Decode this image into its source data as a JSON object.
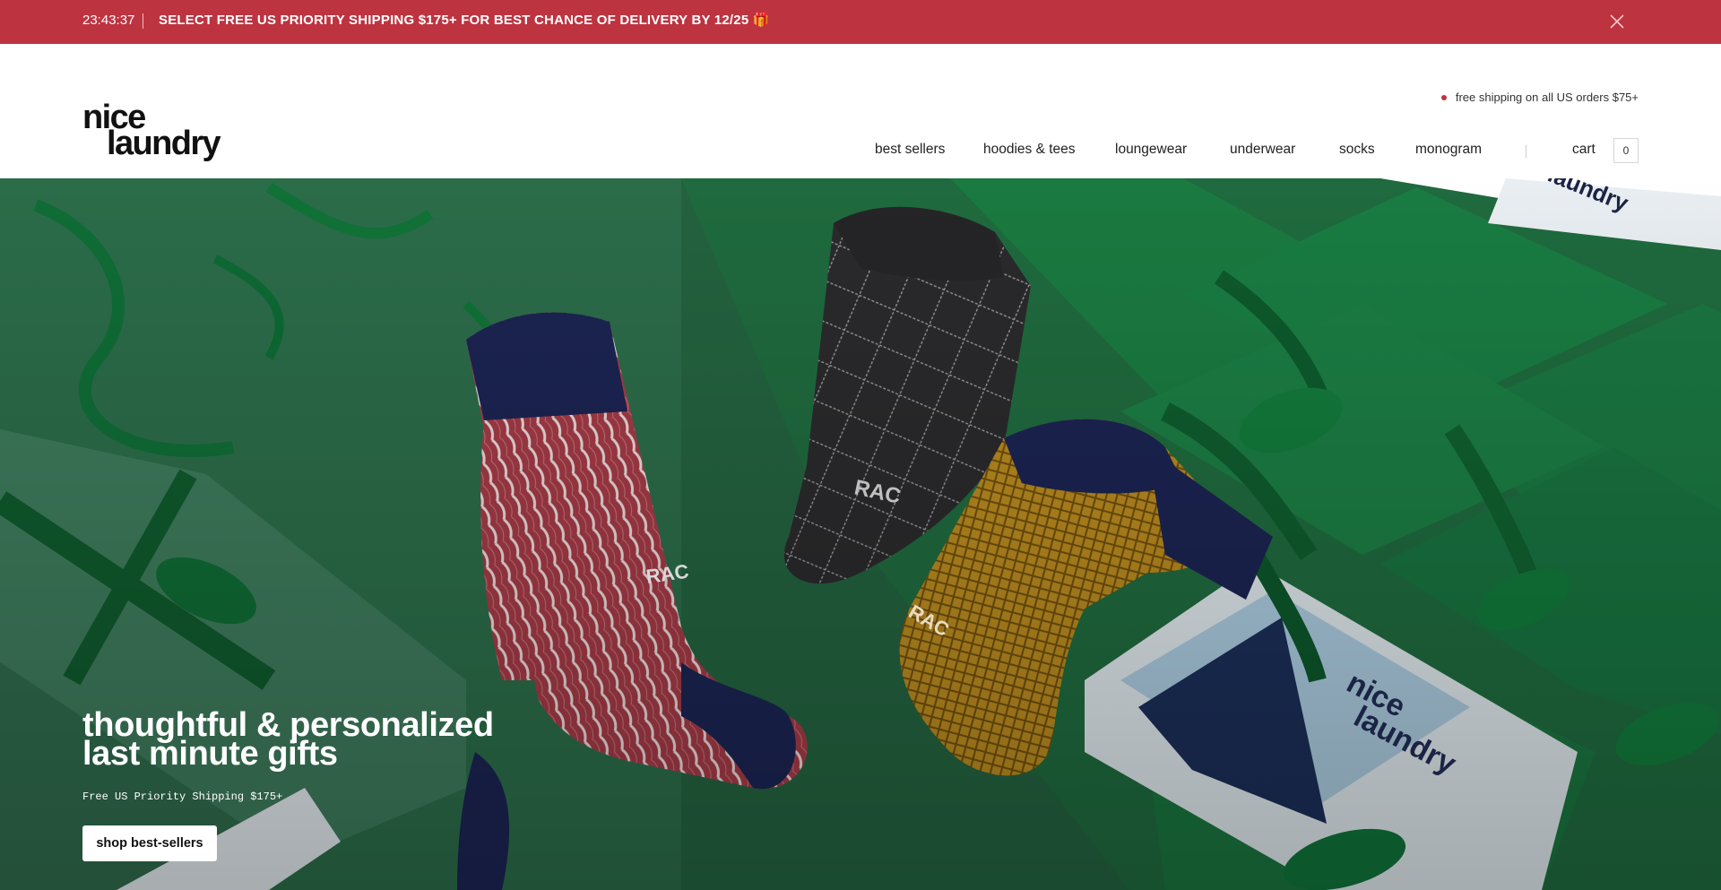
{
  "announcement": {
    "time": "23:43:37",
    "message": "SELECT FREE US PRIORITY SHIPPING $175+ FOR BEST CHANCE OF DELIVERY BY 12/25 🎁",
    "close_icon": "close-icon",
    "background": "#be3340"
  },
  "header": {
    "logo_line1": "nice",
    "logo_line2": "laundry",
    "shipping_note": "free shipping on all US orders $75+",
    "nav": [
      "best sellers",
      "hoodies & tees",
      "loungewear",
      "underwear",
      "socks",
      "monogram"
    ],
    "cart_label": "cart",
    "cart_count": "0"
  },
  "hero": {
    "title_line1": "thoughtful & personalized",
    "title_line2": "last minute gifts",
    "subtitle": "Free US Priority Shipping $175+",
    "cta_label": "shop best-sellers",
    "sock_monogram": "RAC",
    "box_brand_line1": "nice",
    "box_brand_line2": "laundry"
  },
  "colors": {
    "accent": "#be3340",
    "hero_green": "#1f5a3c"
  }
}
